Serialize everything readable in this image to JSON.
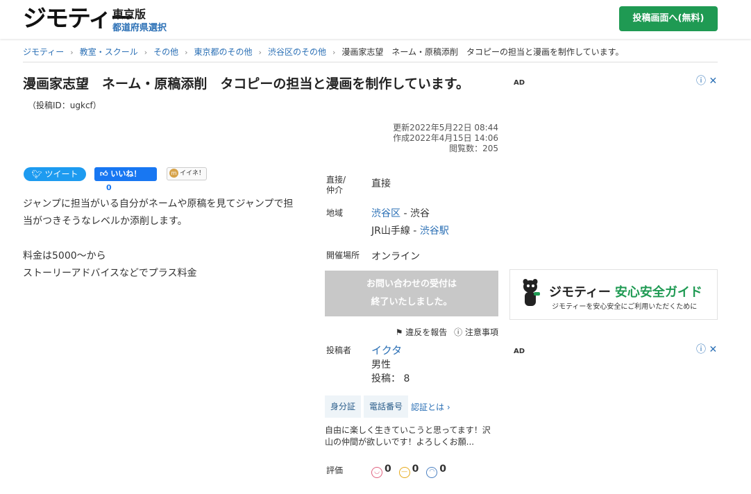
{
  "header": {
    "logo": "ジモティー",
    "edition": "東京版",
    "pref_link": "都道府県選択",
    "post_button": "投稿画面へ(無料)"
  },
  "breadcrumb": {
    "items": [
      "ジモティー",
      "教室・スクール",
      "その他",
      "東京都のその他",
      "渋谷区のその他"
    ],
    "current": "漫画家志望　ネーム・原稿添削　タコピーの担当と漫画を制作しています。"
  },
  "title": "漫画家志望　ネーム・原稿添削　タコピーの担当と漫画を制作しています。",
  "post_id": "（投稿ID：ugkcf）",
  "ad": {
    "label": "AD",
    "info_icon": "ⓘ",
    "close_icon": "✕"
  },
  "meta": {
    "updated": "更新2022年5月22日 08:44",
    "created": "作成2022年4月15日 14:06",
    "views": "閲覧数：205"
  },
  "social": {
    "tweet": "ツイート",
    "fb_label": "いいね！",
    "fb_count": "0",
    "iine_mark": "m",
    "iine": "イイネ！"
  },
  "description": {
    "p1": "ジャンプに担当がいる自分がネームや原稿を見てジャンプで担当がつきそうなレベルか添削します。",
    "p2_line1": "料金は5000～から",
    "p2_line2": "ストーリーアドバイスなどでプラス料金"
  },
  "info": {
    "direct_label_1": "直接/",
    "direct_label_2": "仲介",
    "direct_value": "直接",
    "area_label": "地域",
    "area_ward": "渋谷区",
    "area_sep1": " - ",
    "area_town": "渋谷",
    "line_name": "JR山手線",
    "area_sep2": " - ",
    "station": "渋谷駅",
    "venue_label": "開催場所",
    "venue_value": "オンライン"
  },
  "closed": {
    "line1": "お問い合わせの受付は",
    "line2": "終了いたしました。"
  },
  "report": {
    "report_label": "違反を報告",
    "notice_label": "注意事項"
  },
  "poster": {
    "label": "投稿者",
    "name": "イクタ",
    "gender": "男性",
    "posts": "投稿：  8"
  },
  "verification": {
    "id_badge": "身分証",
    "phone_badge": "電話番号",
    "what_link": "認証とは ›"
  },
  "bio": "自由に楽しく生きていこうと思ってます！沢山の仲間が欲しいです！よろしくお願...",
  "rating": {
    "label": "評価",
    "good": "0",
    "normal": "0",
    "bad": "0"
  },
  "guide": {
    "title_part1": "ジモティー",
    "title_part2": "安心安全ガイド",
    "subtitle": "ジモティーを安心安全にご利用いただくために"
  },
  "colors": {
    "brand_green": "#1f9a53",
    "link_blue": "#2a6fb5",
    "closed_gray": "#c8c8c8"
  }
}
